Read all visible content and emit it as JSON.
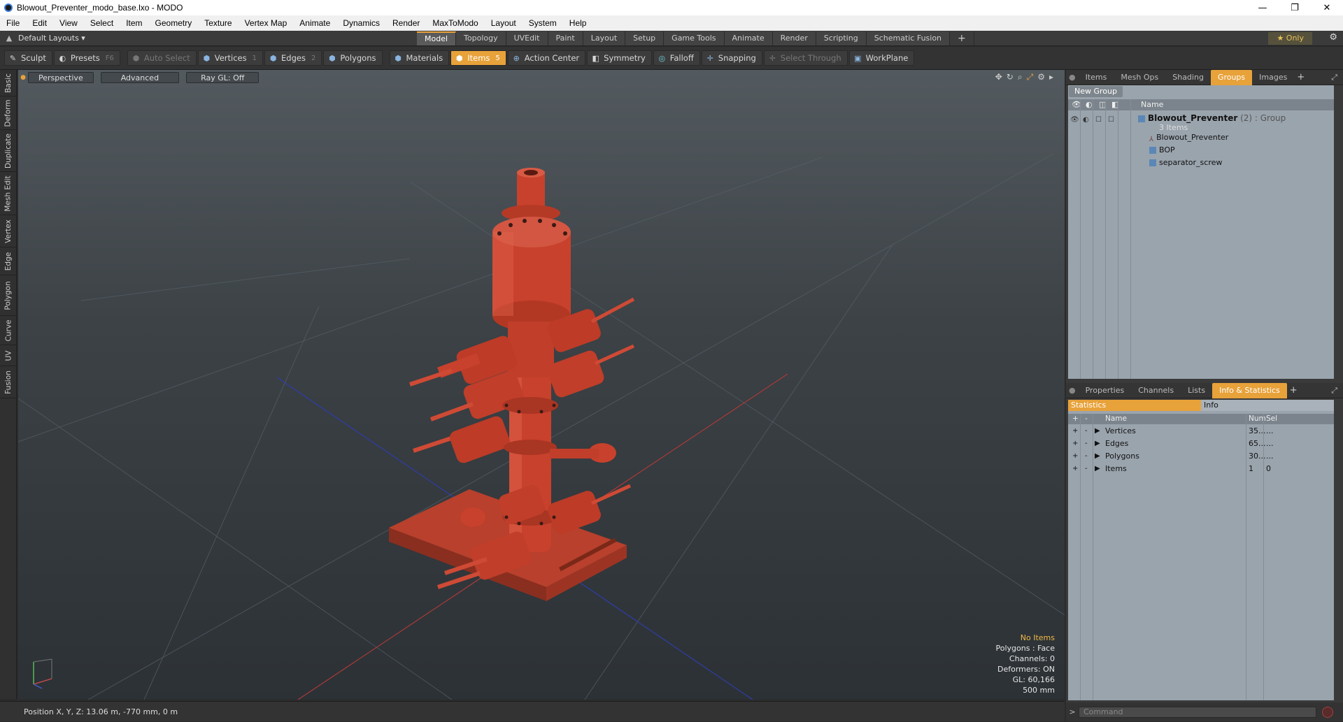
{
  "window": {
    "title": "Blowout_Preventer_modo_base.lxo - MODO",
    "min": "—",
    "max": "❐",
    "close": "✕"
  },
  "menu": [
    "File",
    "Edit",
    "View",
    "Select",
    "Item",
    "Geometry",
    "Texture",
    "Vertex Map",
    "Animate",
    "Dynamics",
    "Render",
    "MaxToModo",
    "Layout",
    "System",
    "Help"
  ],
  "layout": {
    "name": "Default Layouts ▾",
    "tabs": [
      "Model",
      "Topology",
      "UVEdit",
      "Paint",
      "Layout",
      "Setup",
      "Game Tools",
      "Animate",
      "Render",
      "Scripting",
      "Schematic Fusion"
    ],
    "active_tab": "Model",
    "plus": "+",
    "only": "★  Only"
  },
  "toolbar": {
    "sculpt": "Sculpt",
    "presets": "Presets",
    "presets_key": "F6",
    "auto_select": "Auto Select",
    "vertices": "Vertices",
    "vertices_key": "1",
    "edges": "Edges",
    "edges_key": "2",
    "polygons": "Polygons",
    "materials": "Materials",
    "items": "Items",
    "items_key": "5",
    "action_center": "Action Center",
    "symmetry": "Symmetry",
    "falloff": "Falloff",
    "snapping": "Snapping",
    "select_through": "Select Through",
    "workplane": "WorkPlane"
  },
  "left_tabs": [
    "Basic",
    "Deform",
    "Duplicate",
    "Mesh Edit",
    "Vertex",
    "Edge",
    "Polygon",
    "Curve",
    "UV",
    "Fusion"
  ],
  "viewport": {
    "view": "Perspective",
    "shading": "Advanced",
    "raygl": "Ray GL: Off",
    "info": {
      "no_items": "No Items",
      "polygons": "Polygons : Face",
      "channels": "Channels: 0",
      "deformers": "Deformers: ON",
      "gl": "GL: 60,166",
      "scale": "500 mm"
    }
  },
  "status": {
    "position": "Position X, Y, Z:   13.06 m, -770 mm, 0 m"
  },
  "groups_panel": {
    "tabs": [
      "Items",
      "Mesh Ops",
      "Shading",
      "Groups",
      "Images"
    ],
    "active_tab": "Groups",
    "new_group": "New Group",
    "col_name": "Name",
    "group_name": "Blowout_Preventer",
    "group_suffix": " (2) : Group",
    "group_count": "3 Items",
    "children": [
      "Blowout_Preventer",
      "BOP",
      "separator_screw"
    ]
  },
  "stats_panel": {
    "tabs": [
      "Properties",
      "Channels",
      "Lists",
      "Info & Statistics"
    ],
    "active_tab": "Info & Statistics",
    "sub_tabs": [
      "Statistics",
      "Info"
    ],
    "cols": {
      "name": "Name",
      "num": "Num",
      "sel": "Sel"
    },
    "rows": [
      {
        "name": "Vertices",
        "num": "35...",
        "sel": "..."
      },
      {
        "name": "Edges",
        "num": "65...",
        "sel": "..."
      },
      {
        "name": "Polygons",
        "num": "30...",
        "sel": "..."
      },
      {
        "name": "Items",
        "num": "1",
        "sel": "0"
      }
    ]
  },
  "command": {
    "placeholder": "Command",
    "prompt": ">"
  },
  "colors": {
    "accent": "#e8a23a",
    "object": "#c8412c"
  }
}
